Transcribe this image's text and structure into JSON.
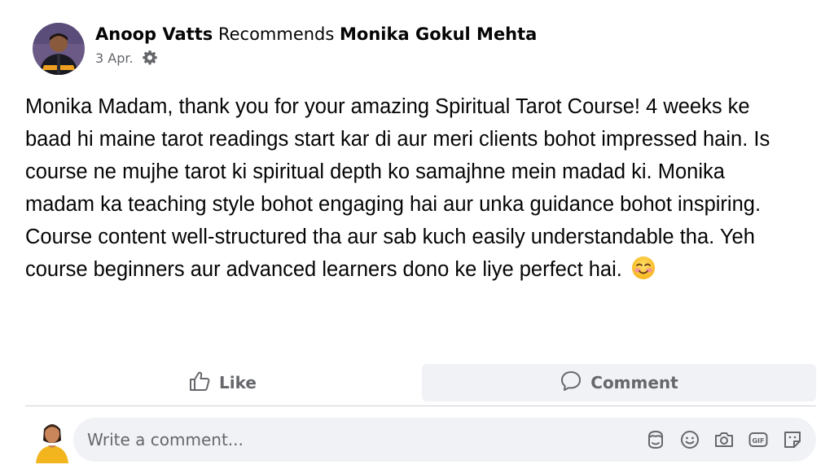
{
  "post": {
    "author": "Anoop Vatts",
    "verb": "Recommends",
    "page": "Monika Gokul Mehta",
    "date": "3 Apr.",
    "privacy_icon": "gear-icon",
    "text": "Monika Madam, thank you for your amazing Spiritual Tarot Course! 4 weeks ke baad hi maine tarot readings start kar di aur meri clients bohot impressed hain. Is course ne mujhe tarot ki spiritual depth ko samajhne mein madad ki. Monika madam ka teaching style bohot engaging hai aur unka guidance bohot inspiring. Course content well-structured tha aur sab kuch easily understandable tha. Yeh course beginners aur advanced learners dono ke liye perfect hai.",
    "emoji_icon": "smiling-face-with-rosy-cheeks-icon"
  },
  "actions": {
    "like_label": "Like",
    "comment_label": "Comment"
  },
  "composer": {
    "placeholder": "Write a comment...",
    "icons": [
      "avatar-sticker-icon",
      "emoji-icon",
      "camera-icon",
      "gif-icon",
      "sticker-icon"
    ]
  },
  "colors": {
    "secondary_text": "#65676b",
    "input_bg": "#f0f2f5",
    "divider": "#ced0d4"
  }
}
